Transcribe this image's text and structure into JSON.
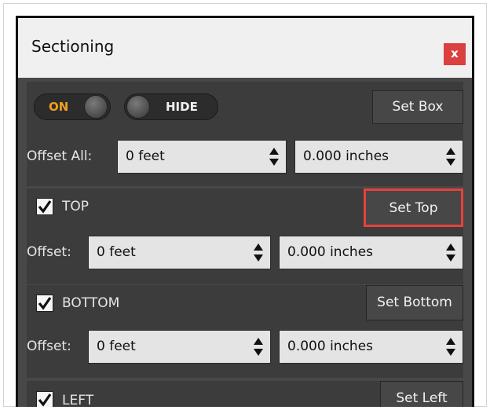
{
  "window": {
    "title": "Sectioning",
    "close_label": "x"
  },
  "controls": {
    "on_label": "ON",
    "hide_label": "HIDE",
    "set_box_label": "Set Box",
    "offset_all_label": "Offset All:",
    "offset_all_feet": "0 feet",
    "offset_all_inches": "0.000 inches"
  },
  "sections": [
    {
      "name": "TOP",
      "checked": true,
      "button": "Set Top",
      "offset_label": "Offset:",
      "feet": "0 feet",
      "inches": "0.000 inches",
      "highlighted": true
    },
    {
      "name": "BOTTOM",
      "checked": true,
      "button": "Set Bottom",
      "offset_label": "Offset:",
      "feet": "0 feet",
      "inches": "0.000 inches",
      "highlighted": false
    },
    {
      "name": "LEFT",
      "checked": true,
      "button": "Set Left"
    }
  ],
  "colors": {
    "accent_on": "#f0a020",
    "highlight": "#e84040",
    "close_button": "#d9403f"
  }
}
